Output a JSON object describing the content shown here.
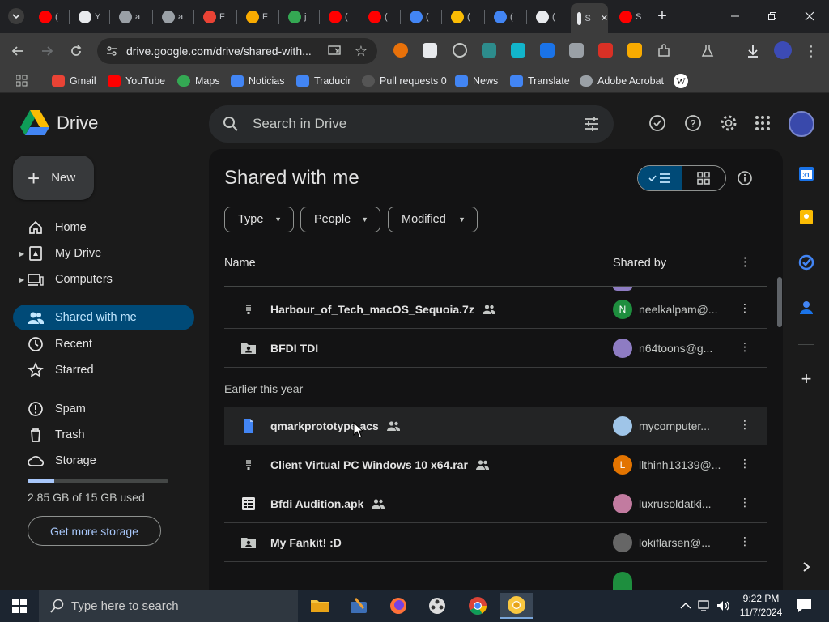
{
  "browser": {
    "tabs": [
      {
        "label": "(",
        "color": "#ff0000"
      },
      {
        "label": "Y",
        "color": "#e8eaed"
      },
      {
        "label": "a",
        "color": "#9aa0a6"
      },
      {
        "label": "a",
        "color": "#9aa0a6"
      },
      {
        "label": "F",
        "color": "#ea4335"
      },
      {
        "label": "F",
        "color": "#f9ab00"
      },
      {
        "label": "j",
        "color": "#34a853"
      },
      {
        "label": "(",
        "color": "#ff0000"
      },
      {
        "label": "(",
        "color": "#ff0000"
      },
      {
        "label": "(",
        "color": "#4285f4"
      },
      {
        "label": "(",
        "color": "#fbbc04"
      },
      {
        "label": "(",
        "color": "#4285f4"
      },
      {
        "label": "(",
        "color": "#e8eaed"
      },
      {
        "label": "S",
        "color": "#e8eaed"
      },
      {
        "label": "S",
        "color": "#ff0000"
      }
    ],
    "url": "drive.google.com/drive/shared-with...",
    "bookmarks": [
      {
        "label": "Gmail",
        "color": "#ea4335"
      },
      {
        "label": "YouTube",
        "color": "#ff0000"
      },
      {
        "label": "Maps",
        "color": "#34a853"
      },
      {
        "label": "Noticias",
        "color": "#4285f4"
      },
      {
        "label": "Traducir",
        "color": "#4285f4"
      },
      {
        "label": "Pull requests 0",
        "color": "#555555"
      },
      {
        "label": "News",
        "color": "#4285f4"
      },
      {
        "label": "Translate",
        "color": "#4285f4"
      },
      {
        "label": "Adobe Acrobat",
        "color": "#9aa0a6"
      }
    ]
  },
  "drive": {
    "logo_text": "Drive",
    "search_placeholder": "Search in Drive",
    "new_label": "New",
    "nav": [
      {
        "label": "Home",
        "icon": "home-icon"
      },
      {
        "label": "My Drive",
        "icon": "my-drive-icon"
      },
      {
        "label": "Computers",
        "icon": "computer-icon"
      },
      {
        "label": "Shared with me",
        "icon": "people-icon"
      },
      {
        "label": "Recent",
        "icon": "clock-icon"
      },
      {
        "label": "Starred",
        "icon": "star-icon"
      },
      {
        "label": "Spam",
        "icon": "spam-icon"
      },
      {
        "label": "Trash",
        "icon": "trash-icon"
      },
      {
        "label": "Storage",
        "icon": "cloud-icon"
      }
    ],
    "storage": {
      "text": "2.85 GB of 15 GB used",
      "fraction": 0.19,
      "button": "Get more storage"
    },
    "page_title": "Shared with me",
    "filters": [
      "Type",
      "People",
      "Modified"
    ],
    "columns": {
      "name": "Name",
      "shared_by": "Shared by"
    },
    "section_earlier": "Earlier this year",
    "rows_recent": [
      {
        "name": "Harbour_of_Tech_macOS_Sequoia.7z",
        "owner": "neelkalpam@...",
        "avatar": "N",
        "avatar_color": "#1e8e3e",
        "icon": "archive-icon",
        "shared": true
      },
      {
        "name": "BFDI TDI",
        "owner": "n64toons@g...",
        "avatar": "",
        "avatar_color": "#8e7cc3",
        "icon": "shared-folder-icon",
        "shared": false
      }
    ],
    "rows_earlier": [
      {
        "name": "qmarkprototype.acs",
        "owner": "mycomputer...",
        "avatar": "",
        "avatar_color": "#9fc5e8",
        "icon": "document-icon",
        "shared": true
      },
      {
        "name": "Client Virtual PC Windows 10 x64.rar",
        "owner": "llthinh13139@...",
        "avatar": "L",
        "avatar_color": "#e37400",
        "icon": "archive-icon",
        "shared": true
      },
      {
        "name": "Bfdi Audition.apk",
        "owner": "luxrusoldatki...",
        "avatar": "",
        "avatar_color": "#c27ba0",
        "icon": "sheet-icon",
        "shared": true
      },
      {
        "name": "My Fankit! :D",
        "owner": "lokiflarsen@...",
        "avatar": "",
        "avatar_color": "#666666",
        "icon": "shared-folder-icon",
        "shared": false
      }
    ]
  },
  "taskbar": {
    "search_placeholder": "Type here to search",
    "time": "9:22 PM",
    "date": "11/7/2024"
  }
}
